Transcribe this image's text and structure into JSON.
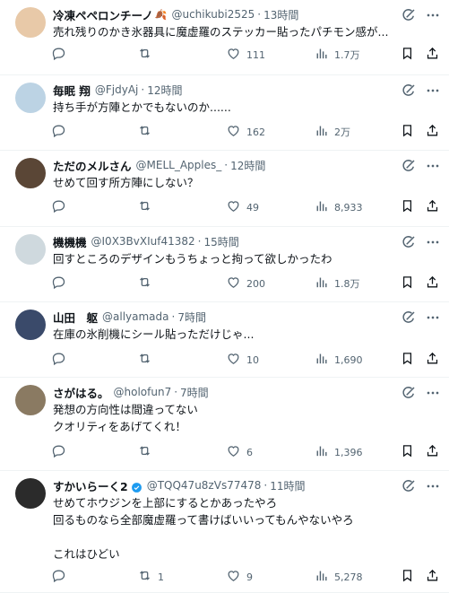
{
  "tweets": [
    {
      "name": "冷凍ペペロンチーノ",
      "emoji": "🍂",
      "handle": "@uchikubi2525",
      "time": "13時間",
      "lines": [
        "売れ残りのかき氷器具に魔虚羅のステッカー貼ったパチモン感が..."
      ],
      "replies": "",
      "retweets": "",
      "likes": "111",
      "views": "1.7万",
      "verified": false,
      "avatar_color": "#e8c9a8"
    },
    {
      "name": "毎眠 翔",
      "handle": "@FjdyAj",
      "time": "12時間",
      "lines": [
        "持ち手が方陣とかでもないのか......"
      ],
      "replies": "",
      "retweets": "",
      "likes": "162",
      "views": "2万",
      "verified": false,
      "avatar_color": "#bcd3e4"
    },
    {
      "name": "ただのメルさん",
      "handle": "@MELL_Apples_",
      "time": "12時間",
      "lines": [
        "せめて回す所方陣にしない？"
      ],
      "replies": "",
      "retweets": "",
      "likes": "49",
      "views": "8,933",
      "verified": false,
      "avatar_color": "#5a4636"
    },
    {
      "name": "機機機",
      "handle": "@I0X3BvXIuf41382",
      "time": "15時間",
      "lines": [
        "回すところのデザインもうちょっと拘って欲しかったわ"
      ],
      "replies": "",
      "retweets": "",
      "likes": "200",
      "views": "1.8万",
      "verified": false,
      "avatar_color": "#cfd9de"
    },
    {
      "name": "山田　躯",
      "handle": "@allyamada",
      "time": "7時間",
      "lines": [
        "在庫の氷削機にシール貼っただけじゃ..."
      ],
      "replies": "",
      "retweets": "",
      "likes": "10",
      "views": "1,690",
      "verified": false,
      "avatar_color": "#3a4a6a"
    },
    {
      "name": "さがはる。",
      "handle": "@holofun7",
      "time": "7時間",
      "lines": [
        "発想の方向性は間違ってない",
        "クオリティをあげてくれ！"
      ],
      "replies": "",
      "retweets": "",
      "likes": "6",
      "views": "1,396",
      "verified": false,
      "avatar_color": "#8a7a62"
    },
    {
      "name": "すかいらーく2",
      "handle": "@TQQ47u8zVs77478",
      "time": "11時間",
      "lines": [
        "せめてホウジンを上部にするとかあったやろ",
        "回るものなら全部魔虚羅って書けばいいってもんやないやろ",
        "",
        "これはひどい"
      ],
      "replies": "",
      "retweets": "1",
      "likes": "9",
      "views": "5,278",
      "verified": true,
      "avatar_color": "#2b2b2b"
    }
  ],
  "icons": {
    "reply": "reply-icon",
    "retweet": "retweet-icon",
    "like": "heart-icon",
    "views": "views-icon",
    "bookmark": "bookmark-icon",
    "share": "share-icon",
    "grok": "grok-icon",
    "more": "more-icon"
  },
  "colors": {
    "text": "#0f1419",
    "muted": "#536471",
    "verified": "#1d9bf0",
    "divider": "#eff3f4"
  }
}
